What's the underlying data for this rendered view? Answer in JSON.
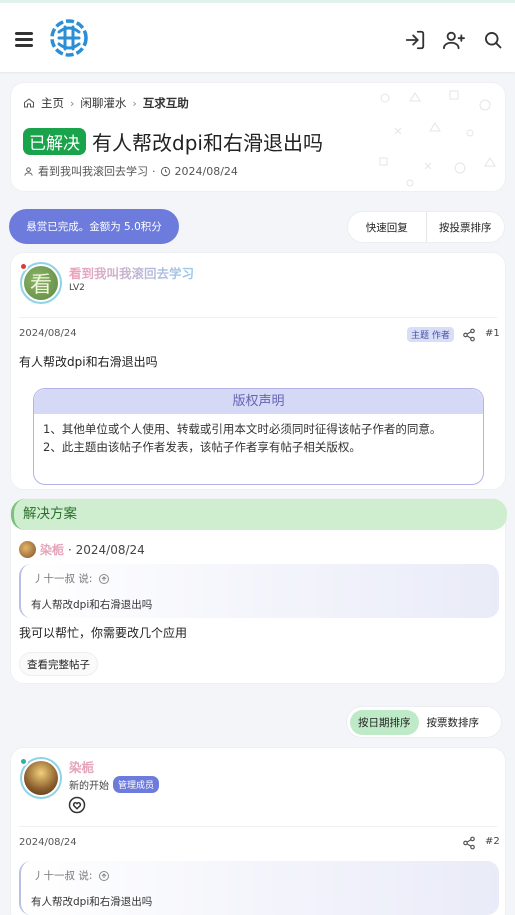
{
  "header": {
    "logo": "site-logo"
  },
  "breadcrumb": {
    "home": "主页",
    "forum": "闲聊灌水",
    "current": "互求互助"
  },
  "thread": {
    "solved_badge": "已解决",
    "title": "有人帮改dpi和右滑退出吗",
    "author": "看到我叫我滚回去学习",
    "date": "2024/08/24"
  },
  "actions": {
    "reward": "悬赏已完成。金额为 5.0积分",
    "quick_reply": "快速回复",
    "sort_votes": "按投票排序"
  },
  "first_post": {
    "avatar_char": "看",
    "username": "看到我叫我滚回去学习",
    "level": "LV2",
    "date": "2024/08/24",
    "author_tag": "主题 作者",
    "number": "#1",
    "body": "有人帮改dpi和右滑退出吗",
    "copyright_title": "版权声明",
    "copyright_lines": [
      "1、其他单位或个人使用、转载或引用本文时必须同时征得该帖子作者的同意。",
      "2、此主题由该帖子作者发表，该帖子作者享有帖子相关版权。"
    ]
  },
  "solution": {
    "heading": "解决方案",
    "user": "染栀",
    "date": "· 2024/08/24",
    "quote_user": "丿十一叔 说:",
    "quote_text": "有人帮改dpi和右滑退出吗",
    "reply_text": "我可以帮忙，你需要改几个应用",
    "view_full": "查看完整帖子"
  },
  "sort": {
    "by_date": "按日期排序",
    "by_votes": "按票数排序"
  },
  "reply": {
    "username": "染栀",
    "user_title": "新的开始",
    "role_tag": "管理成员",
    "date": "2024/08/24",
    "number": "#2",
    "quote_user": "丿十一叔 说:",
    "quote_text": "有人帮改dpi和右滑退出吗"
  },
  "colors": {
    "accent": "#6c7bdc",
    "solved": "#19a34a",
    "solution_bg": "#cfeecf"
  }
}
